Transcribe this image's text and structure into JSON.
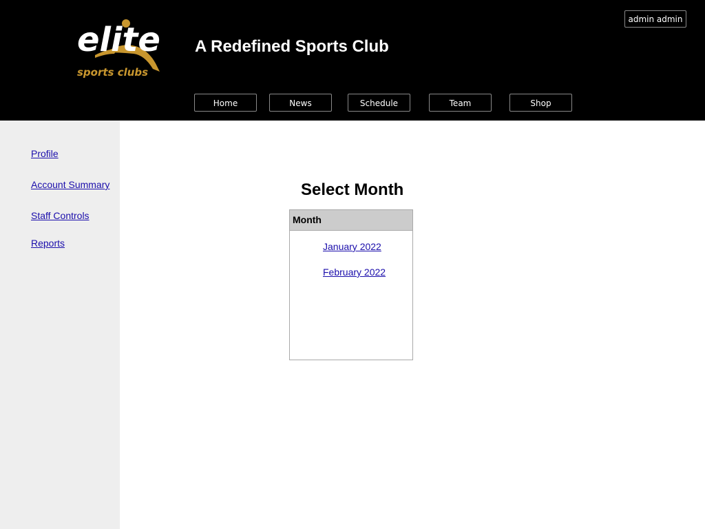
{
  "header": {
    "logo_text": "elite",
    "logo_subtext": "sports clubs",
    "site_title": "A Redefined Sports Club",
    "user_button_label": "admin admin",
    "nav": [
      {
        "label": "Home"
      },
      {
        "label": "News"
      },
      {
        "label": "Schedule"
      },
      {
        "label": "Team"
      },
      {
        "label": "Shop"
      }
    ]
  },
  "sidebar": {
    "links": [
      {
        "label": "Profile"
      },
      {
        "label": "Account Summary"
      },
      {
        "label": "Staff Controls"
      },
      {
        "label": "Reports"
      }
    ]
  },
  "main": {
    "heading": "Select Month",
    "table": {
      "column_header": "Month",
      "rows": [
        {
          "label": "January 2022"
        },
        {
          "label": "February 2022"
        }
      ]
    }
  },
  "colors": {
    "header_bg": "#000000",
    "brand_gold": "#c8962e",
    "sidebar_bg": "#eeeeee",
    "link": "#1a0dab",
    "table_header_bg": "#cccccc"
  }
}
